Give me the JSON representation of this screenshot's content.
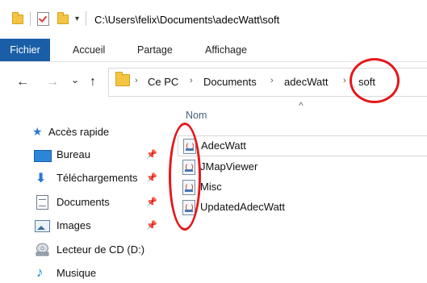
{
  "titlebar": {
    "path": "C:\\Users\\felix\\Documents\\adecWatt\\soft",
    "dropdown_glyph": "▾",
    "icons": [
      "folder-icon",
      "checkmark-properties-icon",
      "new-folder-icon"
    ]
  },
  "ribbon": {
    "tabs": [
      "Fichier",
      "Accueil",
      "Partage",
      "Affichage"
    ],
    "active_tab_color": "#1b5ea8"
  },
  "address_bar": {
    "crumbs": [
      "Ce PC",
      "Documents",
      "adecWatt",
      "soft"
    ],
    "separator": "›"
  },
  "nav_buttons": {
    "back": "←",
    "forward": "→",
    "recent": "⌄",
    "up": "↑"
  },
  "file_list": {
    "column_header": "Nom",
    "sort_indicator": "^",
    "files": [
      {
        "name": "AdecWatt",
        "icon": "jar-file-icon"
      },
      {
        "name": "JMapViewer",
        "icon": "jar-file-icon"
      },
      {
        "name": "Misc",
        "icon": "jar-file-icon"
      },
      {
        "name": "UpdatedAdecWatt",
        "icon": "jar-file-icon"
      }
    ]
  },
  "navigation_pane": {
    "quick_access": "Accès rapide",
    "items": [
      {
        "label": "Bureau",
        "icon": "desktop-icon",
        "pinned": true
      },
      {
        "label": "Téléchargements",
        "icon": "download-icon",
        "pinned": true
      },
      {
        "label": "Documents",
        "icon": "documents-icon",
        "pinned": true
      },
      {
        "label": "Images",
        "icon": "images-icon",
        "pinned": true
      },
      {
        "label": "Lecteur de CD (D:)",
        "icon": "cd-drive-icon",
        "pinned": false
      },
      {
        "label": "Musique",
        "icon": "music-icon",
        "pinned": false
      }
    ],
    "pin_glyph": "📌"
  },
  "colors": {
    "annotation_red": "#e4181b",
    "folder_yellow": "#f4c542",
    "accent_blue": "#2b78d4"
  }
}
